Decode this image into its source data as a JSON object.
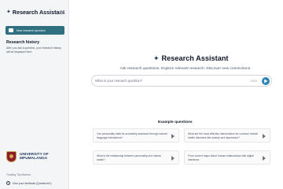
{
  "sidebar": {
    "brand_title": "Research Assistant",
    "new_question_label": "New research question",
    "history_title": "Research history",
    "history_text": "After you ask a question, your research history will be displayed here.",
    "logo_line1": "UNIVERSITY OF",
    "logo_line2": "MPUMALANGA",
    "tagline": "Trusting Tipi Marena",
    "feedback_label": "Give your feedback (Questions?)"
  },
  "main": {
    "title": "Research Assistant",
    "subtitle": "Ask research questions. Explore relevant research. Discover new connections.",
    "search": {
      "placeholder": "What is your research question?",
      "counter": "0/300"
    },
    "examples_title": "Example questions",
    "examples": [
      "Can personality traits be accurately assessed through natural language interactions?",
      "What are the most effective interventions for common mental health disorders like anxiety and depression?",
      "What is the relationship between personality and mental health?",
      "From current maps about human relationships with digital interfaces"
    ]
  },
  "colors": {
    "accent": "#2f6f80",
    "send_button": "#2f86b6",
    "sidebar_bg": "#f4f5f7"
  },
  "icons": [
    "sparkle-icon",
    "collapse-icon",
    "chat-icon",
    "university-crest-icon",
    "help-icon",
    "send-icon",
    "arrow-right-icon"
  ]
}
